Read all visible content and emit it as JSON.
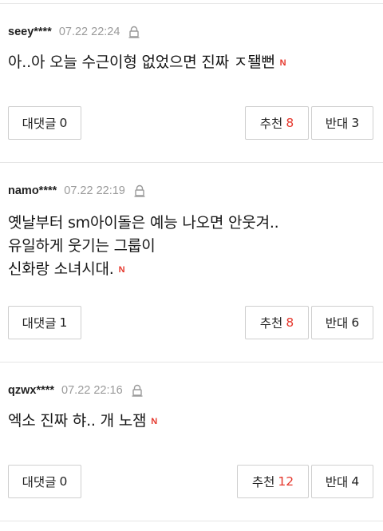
{
  "comments": [
    {
      "user": "seey****",
      "time": "07.22 22:24",
      "lines": [
        "아..아 오늘 수근이형 없었으면 진짜 ㅈ됄뻔"
      ],
      "new_badge": "N",
      "reply": {
        "label": "대댓글",
        "count": "0"
      },
      "like": {
        "label": "추천",
        "count": "8"
      },
      "dislike": {
        "label": "반대",
        "count": "3"
      }
    },
    {
      "user": "namo****",
      "time": "07.22 22:19",
      "lines": [
        "옛날부터 sm아이돌은 예능 나오면 안웃겨..",
        "유일하게 웃기는 그룹이",
        "신화랑 소녀시대."
      ],
      "new_badge": "N",
      "reply": {
        "label": "대댓글",
        "count": "1"
      },
      "like": {
        "label": "추천",
        "count": "8"
      },
      "dislike": {
        "label": "반대",
        "count": "6"
      }
    },
    {
      "user": "qzwx****",
      "time": "07.22 22:16",
      "lines": [
        "엑소 진짜 햐.. 개 노잼"
      ],
      "new_badge": "N",
      "reply": {
        "label": "대댓글",
        "count": "0"
      },
      "like": {
        "label": "추천",
        "count": "12"
      },
      "dislike": {
        "label": "반대",
        "count": "4"
      }
    }
  ],
  "icons": {
    "report": "lock-report-icon",
    "new": "new-badge"
  },
  "colors": {
    "accent": "#e5372c",
    "meta_gray": "#9a9a9a",
    "border": "#cfcfcf"
  }
}
